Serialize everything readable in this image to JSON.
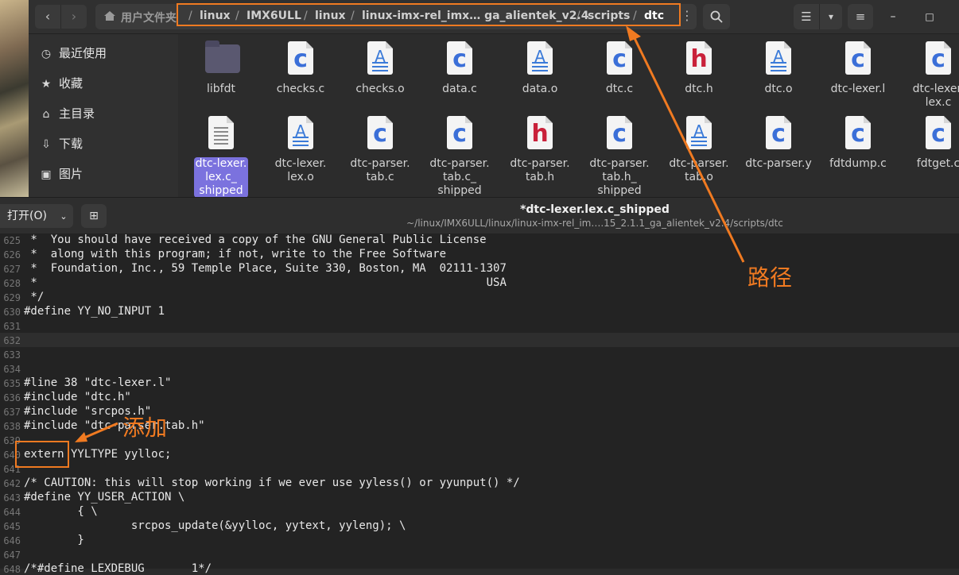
{
  "file_manager": {
    "path": {
      "home": "用户文件夹",
      "crumbs": [
        "linux",
        "IMX6ULL",
        "linux",
        "linux-imx-rel_imx… ga_alientek_v2.4",
        "scripts",
        "dtc"
      ]
    },
    "sidebar": [
      {
        "label": "最近使用",
        "icon": "clock-icon"
      },
      {
        "label": "收藏",
        "icon": "star-icon"
      },
      {
        "label": "主目录",
        "icon": "home-icon"
      },
      {
        "label": "下载",
        "icon": "download-icon"
      },
      {
        "label": "图片",
        "icon": "picture-icon"
      }
    ],
    "files_row1": [
      "libfdt",
      "checks.c",
      "checks.o",
      "data.c",
      "data.o",
      "dtc.c",
      "dtc.h",
      "dtc.o",
      "dtc-lexer.l",
      "dtc-lexer.\nlex.c"
    ],
    "files_row2": [
      "dtc-lexer.\nlex.c_\nshipped",
      "dtc-lexer.\nlex.o",
      "dtc-parser.\ntab.c",
      "dtc-parser.\ntab.c_\nshipped",
      "dtc-parser.\ntab.h",
      "dtc-parser.\ntab.h_\nshipped",
      "dtc-parser.\ntab.o",
      "dtc-parser.y",
      "fdtdump.c",
      "fdtget.c"
    ]
  },
  "editor": {
    "open_label": "打开(O)",
    "title": "*dtc-lexer.lex.c_shipped",
    "subtitle": "~/linux/IMX6ULL/linux/linux-imx-rel_im….15_2.1.1_ga_alientek_v2.4/scripts/dtc",
    "lines": [
      {
        "n": "625",
        "t": " *  You should have received a copy of the GNU General Public License"
      },
      {
        "n": "626",
        "t": " *  along with this program; if not, write to the Free Software"
      },
      {
        "n": "627",
        "t": " *  Foundation, Inc., 59 Temple Place, Suite 330, Boston, MA  02111-1307"
      },
      {
        "n": "628",
        "t": " *                                                                   USA"
      },
      {
        "n": "629",
        "t": " */"
      },
      {
        "n": "630",
        "t": "#define YY_NO_INPUT 1"
      },
      {
        "n": "631",
        "t": ""
      },
      {
        "n": "632",
        "t": ""
      },
      {
        "n": "633",
        "t": ""
      },
      {
        "n": "634",
        "t": ""
      },
      {
        "n": "635",
        "t": "#line 38 \"dtc-lexer.l\""
      },
      {
        "n": "636",
        "t": "#include \"dtc.h\""
      },
      {
        "n": "637",
        "t": "#include \"srcpos.h\""
      },
      {
        "n": "638",
        "t": "#include \"dtc-parser.tab.h\""
      },
      {
        "n": "639",
        "t": ""
      },
      {
        "n": "640",
        "t": "extern YYLTYPE yylloc;"
      },
      {
        "n": "641",
        "t": ""
      },
      {
        "n": "642",
        "t": "/* CAUTION: this will stop working if we ever use yyless() or yyunput() */"
      },
      {
        "n": "643",
        "t": "#define YY_USER_ACTION \\"
      },
      {
        "n": "644",
        "t": "        { \\"
      },
      {
        "n": "645",
        "t": "                srcpos_update(&yylloc, yytext, yyleng); \\"
      },
      {
        "n": "646",
        "t": "        }"
      },
      {
        "n": "647",
        "t": ""
      },
      {
        "n": "648",
        "t": "/*#define LEXDEBUG       1*/"
      }
    ]
  },
  "annotations": {
    "path_label": "路径",
    "add_label": "添加"
  },
  "colors": {
    "accent": "#f07a21",
    "selection": "#7b72de"
  }
}
